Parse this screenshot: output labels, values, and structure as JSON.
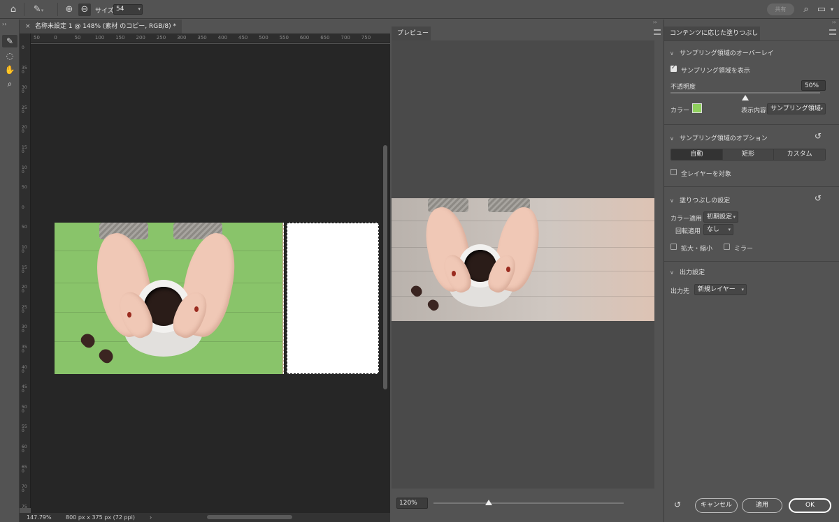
{
  "options_bar": {
    "home_icon": "home-icon",
    "brush_icon": "brush-icon",
    "size_label": "サイズ",
    "size_value": "54",
    "share_label": "共有"
  },
  "document": {
    "tab_title": "名称未設定 1 @ 148% (素材 のコピー, RGB/8) *",
    "ruler_h_ticks": [
      "50",
      "0",
      "50",
      "100",
      "150",
      "200",
      "250",
      "300",
      "350",
      "400",
      "450",
      "500",
      "550",
      "600",
      "650",
      "700",
      "750"
    ],
    "ruler_v_ticks": [
      "0",
      "350",
      "300",
      "250",
      "200",
      "150",
      "100",
      "50",
      "0",
      "50",
      "100",
      "150",
      "200",
      "250",
      "300",
      "350",
      "400",
      "450",
      "500",
      "550",
      "600",
      "650",
      "700",
      "750"
    ],
    "zoom_status": "147.79%",
    "size_status": "800 px x 375 px (72 ppi)"
  },
  "preview": {
    "tab_label": "プレビュー",
    "zoom_value": "120%",
    "zoom_fraction": 0.29
  },
  "panel": {
    "tab_title": "コンテンツに応じた塗りつぶし",
    "overlay": {
      "header": "サンプリング領域のオーバーレイ",
      "show_label": "サンプリング領域を表示",
      "show_checked": true,
      "opacity_label": "不透明度",
      "opacity_value": "50%",
      "opacity_fraction": 0.5,
      "color_label": "カラー",
      "color_hex": "#8fd05d",
      "display_label": "表示内容",
      "display_value": "サンプリング領域"
    },
    "options": {
      "header": "サンプリング領域のオプション",
      "segments": [
        "自動",
        "矩形",
        "カスタム"
      ],
      "active_segment": 0,
      "all_layers_label": "全レイヤーを対象"
    },
    "fill": {
      "header": "塗りつぶしの設定",
      "color_adapt_label": "カラー適用",
      "color_adapt_value": "初期設定",
      "rotate_label": "回転適用",
      "rotate_value": "なし",
      "scale_label": "拡大・縮小",
      "mirror_label": "ミラー"
    },
    "output": {
      "header": "出力設定",
      "output_label": "出力先",
      "output_value": "新規レイヤー"
    },
    "buttons": {
      "cancel": "キャンセル",
      "apply": "適用",
      "ok": "OK"
    }
  }
}
